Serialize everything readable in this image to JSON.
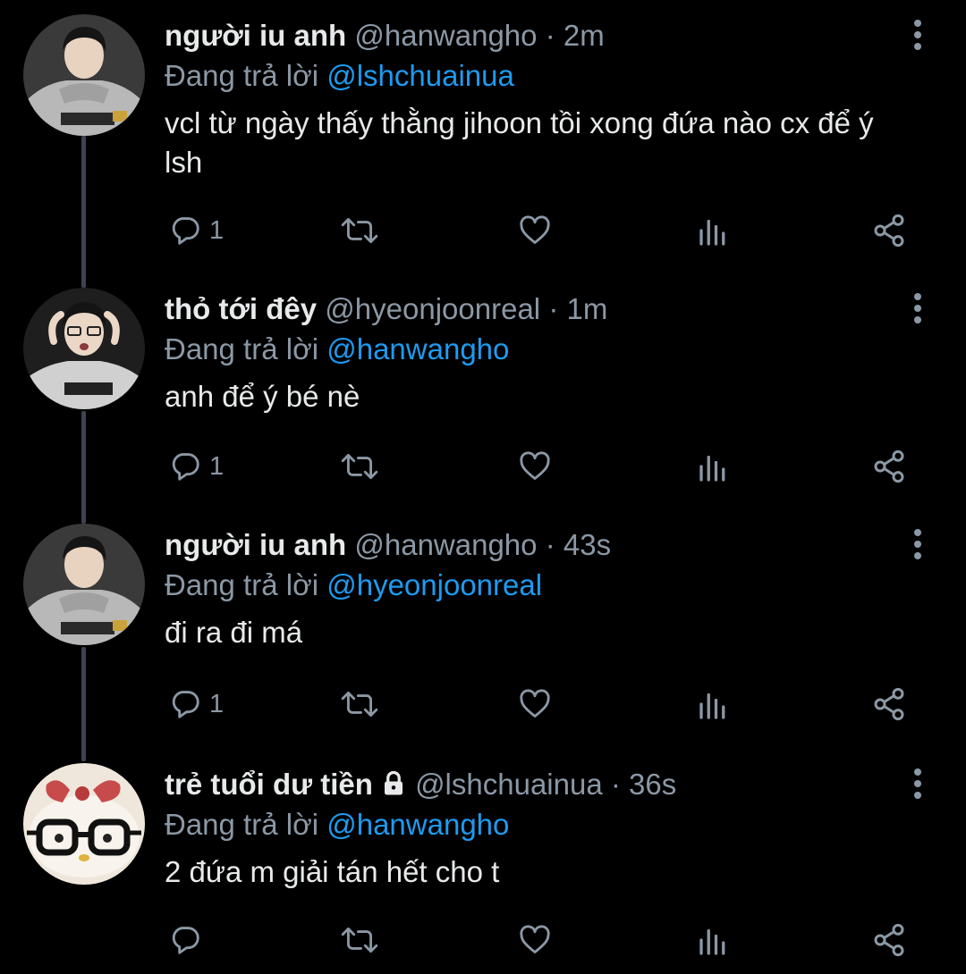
{
  "tweets": [
    {
      "name": "người iu anh",
      "handle": "@hanwangho",
      "separator": "·",
      "time": "2m",
      "reply_prefix": "Đang trả lời",
      "reply_to": "@lshchuainua",
      "text": "vcl từ ngày thấy thằng jihoon tồi xong đứa nào cx để ý lsh",
      "reply_count": "1",
      "locked": false
    },
    {
      "name": "thỏ tới đêy",
      "handle": "@hyeonjoonreal",
      "separator": "·",
      "time": "1m",
      "reply_prefix": "Đang trả lời",
      "reply_to": "@hanwangho",
      "text": "anh để ý bé nè",
      "reply_count": "1",
      "locked": false
    },
    {
      "name": "người iu anh",
      "handle": "@hanwangho",
      "separator": "·",
      "time": "43s",
      "reply_prefix": "Đang trả lời",
      "reply_to": "@hyeonjoonreal",
      "text": "đi ra đi má",
      "reply_count": "1",
      "locked": false
    },
    {
      "name": "trẻ tuổi dư tiền",
      "handle": "@lshchuainua",
      "separator": "·",
      "time": "36s",
      "reply_prefix": "Đang trả lời",
      "reply_to": "@hanwangho",
      "text": "2 đứa m giải tán hết cho t",
      "reply_count": "",
      "locked": true
    }
  ],
  "icons": {
    "reply": "reply-icon",
    "retweet": "retweet-icon",
    "like": "heart-icon",
    "analytics": "analytics-icon",
    "share": "share-icon",
    "more": "more-vertical-icon",
    "lock": "lock-icon"
  },
  "colors": {
    "background": "#000000",
    "text": "#e7e9ea",
    "muted": "#8b98a5",
    "accent": "#1d9bf0",
    "thread_line": "#3d4450"
  }
}
